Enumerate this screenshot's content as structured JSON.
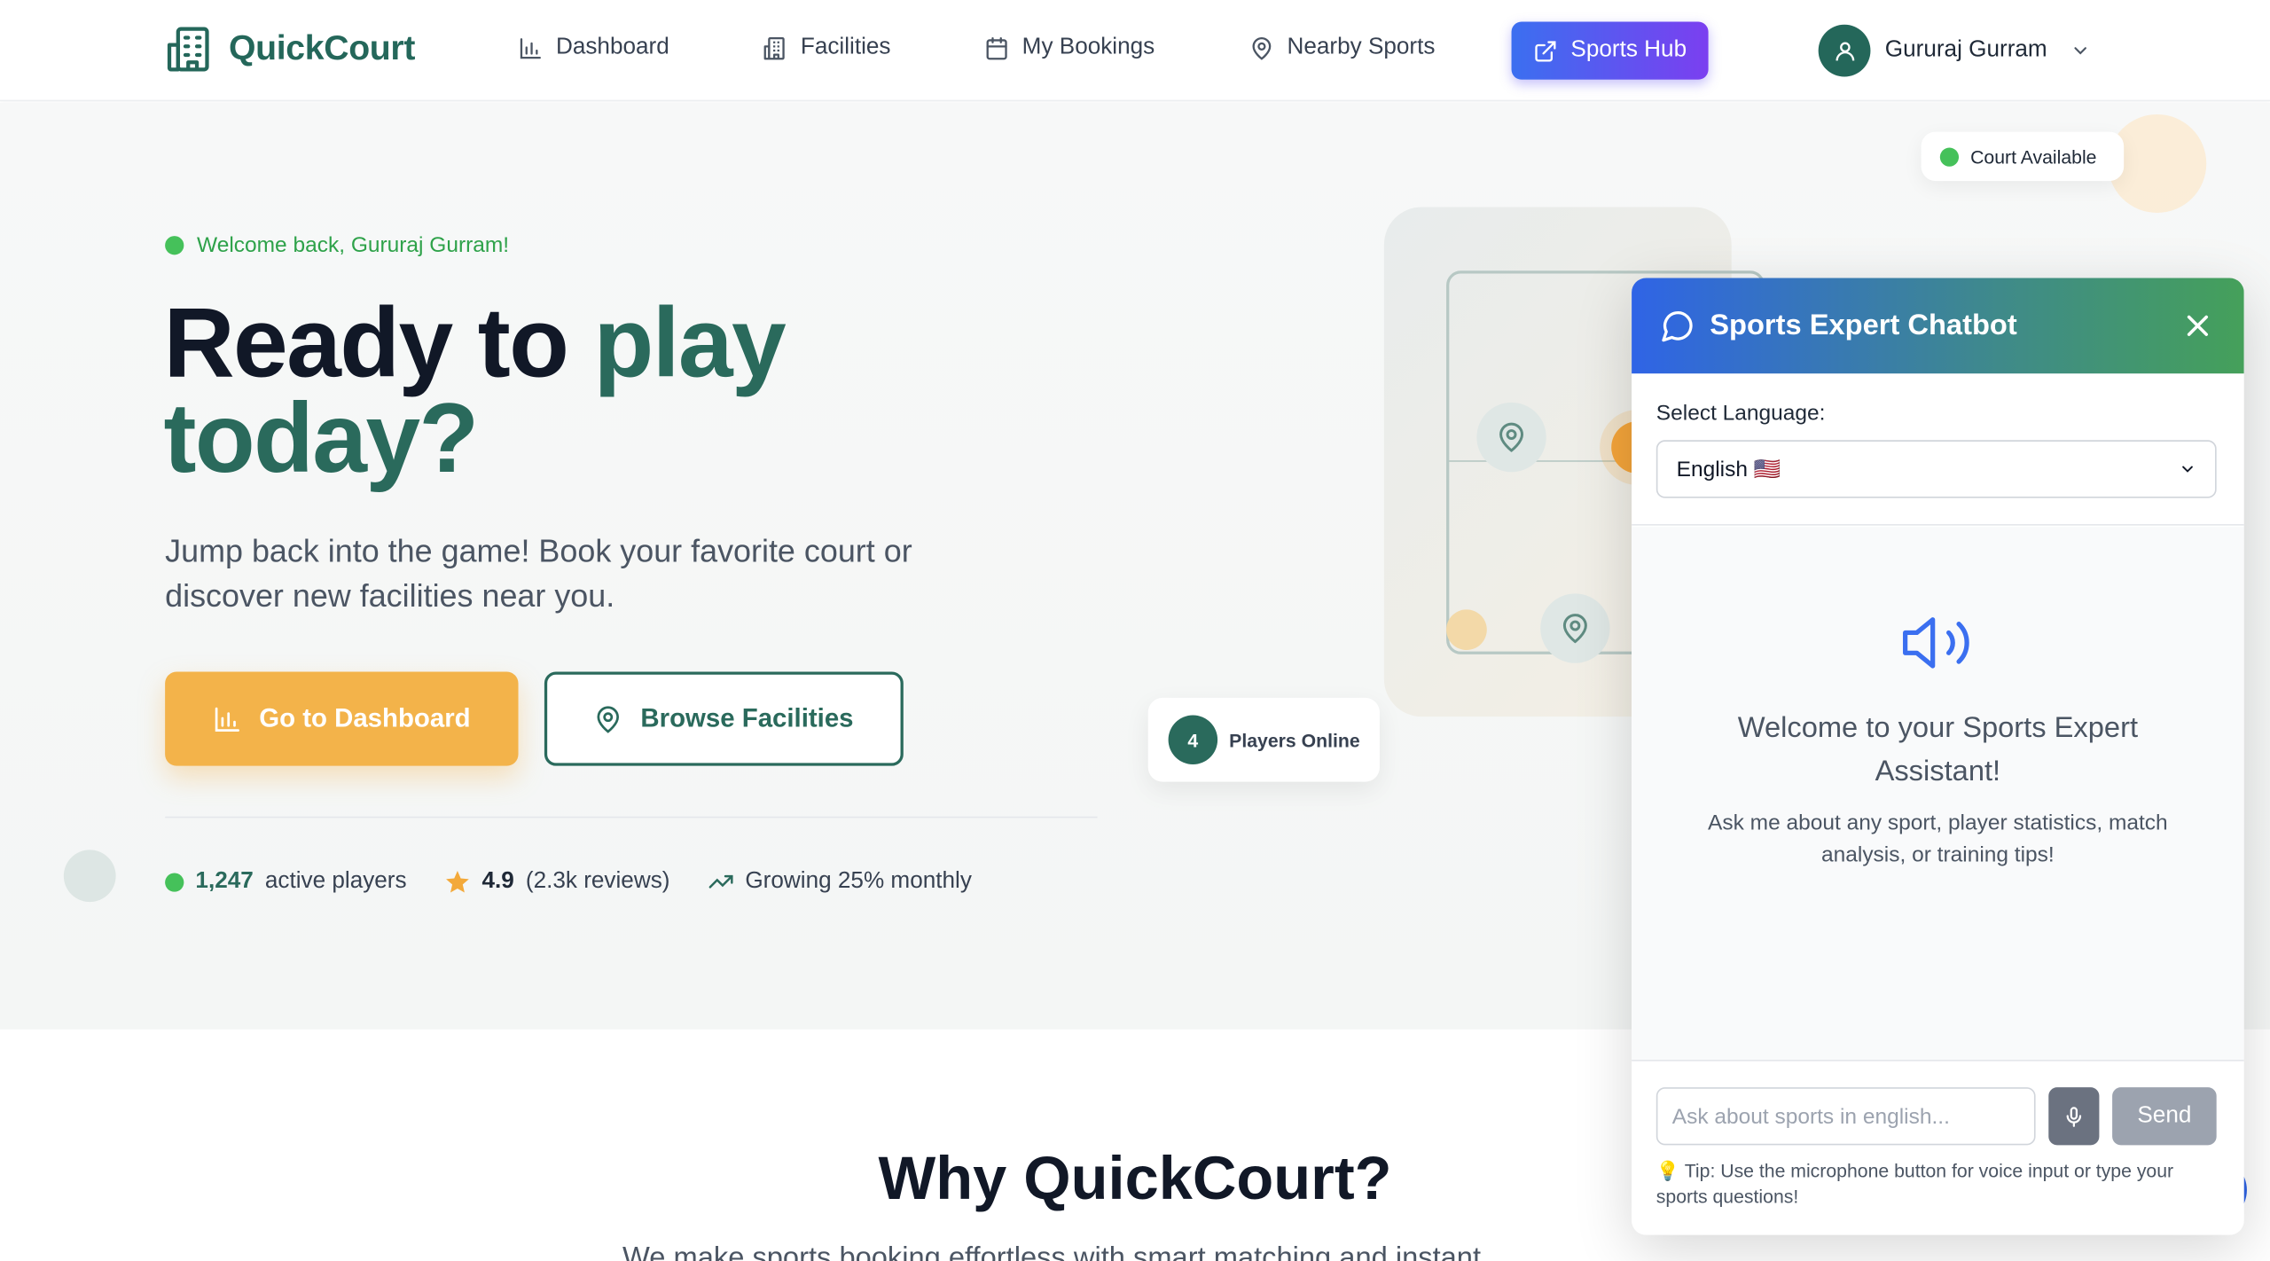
{
  "nav": {
    "brand": "QuickCourt",
    "items": [
      {
        "label": "Dashboard",
        "icon": "bar-chart-icon"
      },
      {
        "label": "Facilities",
        "icon": "building-icon"
      },
      {
        "label": "My Bookings",
        "icon": "calendar-icon"
      },
      {
        "label": "Nearby Sports",
        "icon": "map-pin-icon"
      }
    ],
    "hub_label": "Sports Hub",
    "user_name": "Gururaj Gurram"
  },
  "hero": {
    "welcome": "Welcome back, Gururaj Gurram!",
    "headline_1": "Ready to ",
    "headline_accent": "play",
    "headline_2": "today?",
    "subtext": "Jump back into the game! Book your favorite court or discover new facilities near you.",
    "primary_button": "Go to Dashboard",
    "secondary_button": "Browse Facilities",
    "stats": {
      "players_count": "1,247",
      "players_label": "active players",
      "rating": "4.9",
      "reviews": "(2.3k reviews)",
      "growth": "Growing 25% monthly"
    },
    "court_available": "Court Available",
    "players_online_count": "4",
    "players_online_label": "Players Online"
  },
  "section": {
    "title": "Why QuickCourt?",
    "subtitle_partial": "We make sports booking effortless with smart matching and instant"
  },
  "chatbot": {
    "title": "Sports Expert Chatbot",
    "language_label": "Select Language:",
    "language_value": "English 🇺🇸",
    "welcome": "Welcome to your Sports Expert Assistant!",
    "help": "Ask me about any sport, player statistics, match analysis, or training tips!",
    "input_placeholder": "Ask about sports in english...",
    "send_label": "Send",
    "tip": "💡 Tip: Use the microphone button for voice input or type your sports questions!"
  },
  "colors": {
    "brand": "#24675a",
    "accent_orange": "#f3b34a",
    "hub_gradient_start": "#3b6ff0",
    "hub_gradient_end": "#7b3ff0",
    "chat_header_start": "#2f64e6",
    "chat_header_end": "#45a05a"
  }
}
